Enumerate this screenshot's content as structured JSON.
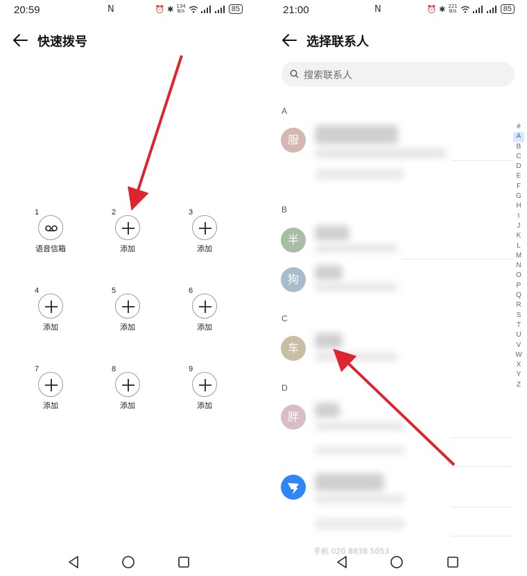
{
  "left": {
    "status": {
      "time": "20:59",
      "nfc": "N",
      "speed_value": "134",
      "speed_unit": "B/s",
      "battery": "85"
    },
    "title": "快速拨号",
    "slots": [
      {
        "number": "1",
        "label": "语音信箱",
        "icon": "voicemail-icon"
      },
      {
        "number": "2",
        "label": "添加",
        "icon": "plus-icon"
      },
      {
        "number": "3",
        "label": "添加",
        "icon": "plus-icon"
      },
      {
        "number": "4",
        "label": "添加",
        "icon": "plus-icon"
      },
      {
        "number": "5",
        "label": "添加",
        "icon": "plus-icon"
      },
      {
        "number": "6",
        "label": "添加",
        "icon": "plus-icon"
      },
      {
        "number": "7",
        "label": "添加",
        "icon": "plus-icon"
      },
      {
        "number": "8",
        "label": "添加",
        "icon": "plus-icon"
      },
      {
        "number": "9",
        "label": "添加",
        "icon": "plus-icon"
      }
    ]
  },
  "right": {
    "status": {
      "time": "21:00",
      "nfc": "N",
      "speed_value": "221",
      "speed_unit": "B/s",
      "battery": "85"
    },
    "title": "选择联系人",
    "search_placeholder": "搜索联系人",
    "sections": [
      {
        "letter": "A",
        "contacts": [
          {
            "avatar_char": "服",
            "avatar_color": "#d3b7b0"
          }
        ]
      },
      {
        "letter": "B",
        "contacts": [
          {
            "avatar_char": "半",
            "avatar_color": "#a9bca6"
          },
          {
            "avatar_char": "狗",
            "avatar_color": "#a9bccb"
          }
        ]
      },
      {
        "letter": "C",
        "contacts": [
          {
            "avatar_char": "车",
            "avatar_color": "#c9bea3"
          }
        ]
      },
      {
        "letter": "D",
        "contacts": [
          {
            "avatar_char": "胖",
            "avatar_color": "#d9bcc4"
          }
        ]
      }
    ],
    "extra_contact_icon": "dingtalk-icon",
    "index_letters": [
      "#",
      "A",
      "B",
      "C",
      "D",
      "E",
      "F",
      "G",
      "H",
      "I",
      "J",
      "K",
      "L",
      "M",
      "N",
      "O",
      "P",
      "Q",
      "R",
      "S",
      "T",
      "U",
      "V",
      "W",
      "X",
      "Y",
      "Z"
    ],
    "active_index": "A",
    "faded_footer": "手机 020 8838 5053"
  },
  "colors": {
    "annotation_arrow": "#e0242f",
    "accent": "#2a6bd8"
  }
}
